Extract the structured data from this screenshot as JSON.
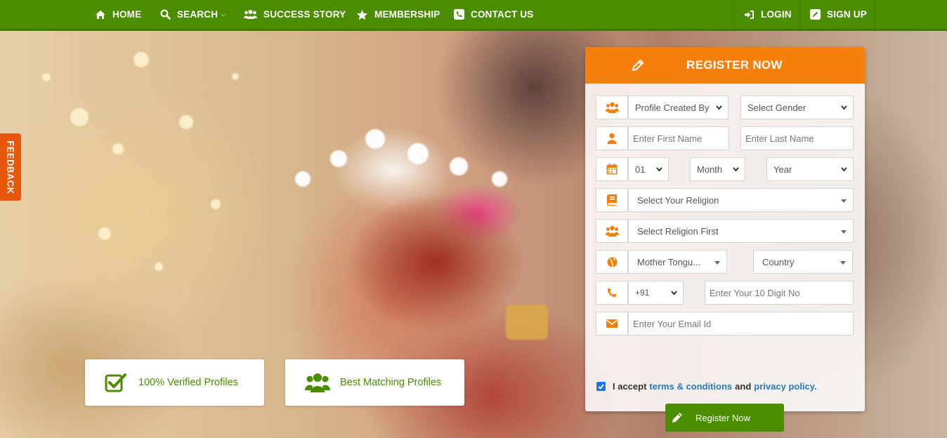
{
  "nav": {
    "home": "HOME",
    "search": "SEARCH",
    "success_story": "SUCCESS STORY",
    "membership": "MEMBERSHIP",
    "contact_us": "CONTACT US",
    "login": "LOGIN",
    "signup": "SIGN UP"
  },
  "feedback": "FEEDBACK",
  "features": {
    "verified": "100% Verified Profiles",
    "matching": "Best Matching Profiles"
  },
  "register": {
    "title": "REGISTER NOW",
    "profile_created_by": "Profile Created By",
    "gender": "Select Gender",
    "first_name_placeholder": "Enter First Name",
    "last_name_placeholder": "Enter Last Name",
    "day": "01",
    "month": "Month",
    "year": "Year",
    "religion": "Select Your Religion",
    "caste": "Select Religion First",
    "mother_tongue": "Mother Tongu...",
    "country": "Country",
    "country_code": "+91",
    "phone_placeholder": "Enter Your 10 Digit No",
    "email_placeholder": "Enter Your Email Id",
    "accept_prefix": "I accept",
    "terms": "terms & conditions",
    "and": "and",
    "privacy": "privacy policy.",
    "button": "Register Now"
  },
  "colors": {
    "nav_green": "#4a8e00",
    "header_orange": "#f67f0a",
    "feedback_orange": "#e8580c",
    "link_blue": "#2b7bb9",
    "icon_orange": "#f67f0a"
  }
}
